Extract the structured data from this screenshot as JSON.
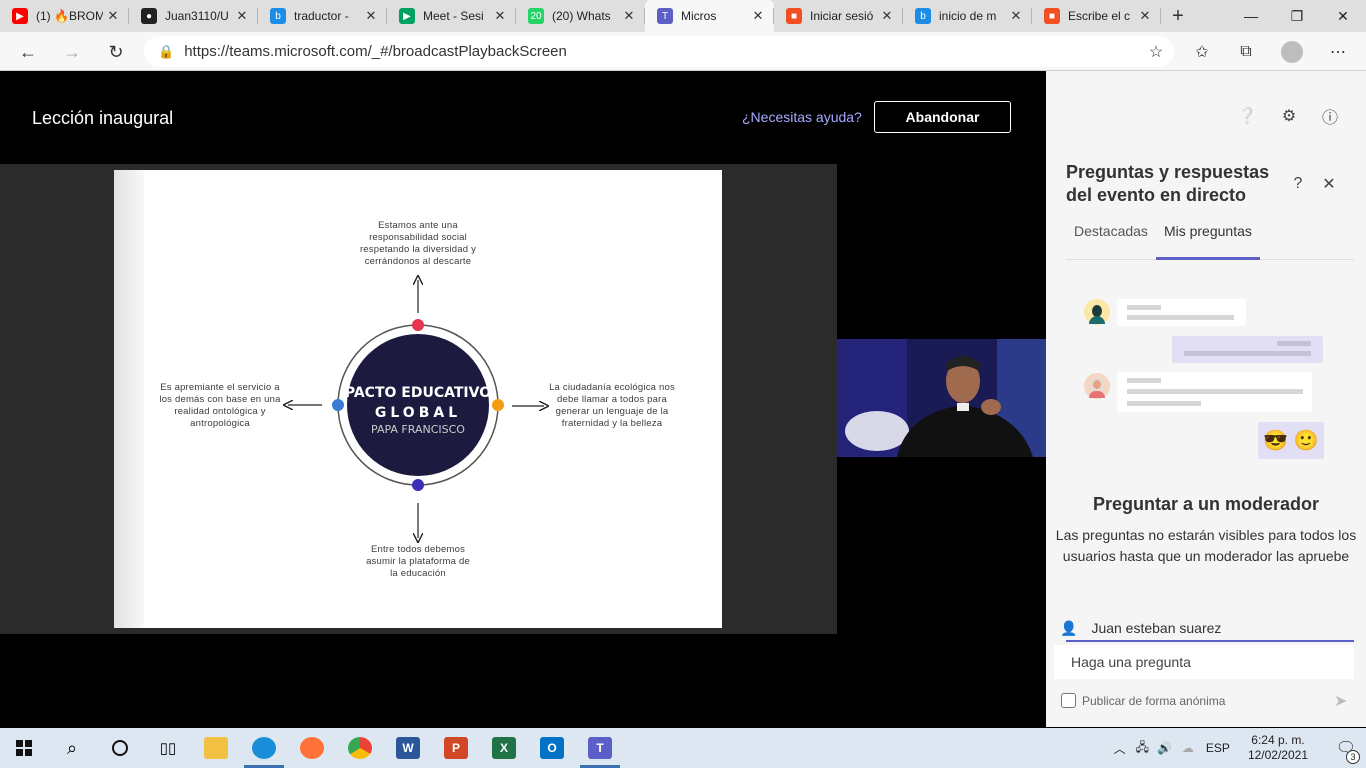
{
  "browser": {
    "tabs": [
      {
        "title": "(1) 🔥BROM",
        "icon": "youtube-icon",
        "color": "#ff0000",
        "glyph": "▶"
      },
      {
        "title": "Juan3110/U",
        "icon": "github-icon",
        "color": "#222222",
        "glyph": "●"
      },
      {
        "title": "traductor -",
        "icon": "bing-icon",
        "color": "#1b8de6",
        "glyph": "b"
      },
      {
        "title": "Meet - Sesi",
        "icon": "meet-icon",
        "color": "#00a261",
        "glyph": "▶"
      },
      {
        "title": "(20) Whats",
        "icon": "whatsapp-icon",
        "color": "#25d366",
        "glyph": "20"
      },
      {
        "title": "Micros",
        "icon": "teams-icon",
        "color": "#5b5fc7",
        "glyph": "T",
        "active": true
      },
      {
        "title": "Iniciar sesió",
        "icon": "microsoft-icon",
        "color": "#f25022",
        "glyph": "■"
      },
      {
        "title": "inicio de m",
        "icon": "bing-icon",
        "color": "#1b8de6",
        "glyph": "b"
      },
      {
        "title": "Escribe el c",
        "icon": "microsoft-icon",
        "color": "#f25022",
        "glyph": "■"
      }
    ],
    "tab_close": "✕",
    "new_tab": "+",
    "url": "https://teams.microsoft.com/_#/broadcastPlaybackScreen"
  },
  "event": {
    "title": "Lección inaugural",
    "help_link": "¿Necesitas ayuda?",
    "leave_button": "Abandonar"
  },
  "slide": {
    "center_line1": "PACTO EDUCATIVO",
    "center_line2": "GLOBAL",
    "center_line3": "PAPA FRANCISCO",
    "top_text": [
      "Estamos ante una",
      "responsabilidad social",
      "respetando la diversidad y",
      "cerrándonos al descarte"
    ],
    "left_text": [
      "Es apremiante el servicio a",
      "los demás con base en una",
      "realidad ontológica y",
      "antropológica"
    ],
    "right_text": [
      "La ciudadanía ecológica nos",
      "debe llamar a todos para",
      "generar un lenguaje de la",
      "fraternidad y la belleza"
    ],
    "bottom_text": [
      "Entre todos debemos",
      "asumir la plataforma de",
      "la educación"
    ],
    "colors": {
      "top": "#e8344e",
      "left": "#3a7bd5",
      "right": "#f39c12",
      "bottom": "#3b2fb5",
      "circle": "#1c1a3e"
    }
  },
  "panel": {
    "title": "Preguntas y respuestas del evento en directo",
    "tabs": [
      "Destacadas",
      "Mis preguntas"
    ],
    "selected_tab": "Mis preguntas",
    "ask_title": "Preguntar a un moderador",
    "ask_desc": "Las preguntas no estarán visibles para todos los usuarios hasta que un moderador las apruebe",
    "user_name": "Juan esteban suarez",
    "input_placeholder": "Haga una pregunta",
    "anonymous_label": "Publicar de forma anónima"
  },
  "taskbar": {
    "time": "6:24 p. m.",
    "date": "12/02/2021",
    "language": "ESP",
    "notification_count": "3"
  }
}
